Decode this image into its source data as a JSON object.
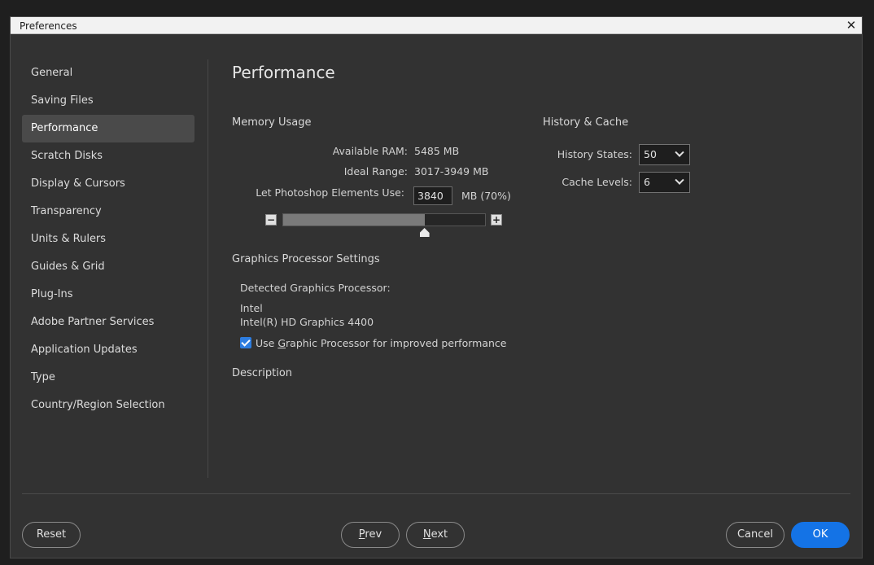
{
  "window": {
    "title": "Preferences",
    "close_glyph": "✕"
  },
  "sidebar": {
    "items": [
      {
        "label": "General"
      },
      {
        "label": "Saving Files"
      },
      {
        "label": "Performance",
        "active": true
      },
      {
        "label": "Scratch Disks"
      },
      {
        "label": "Display & Cursors"
      },
      {
        "label": "Transparency"
      },
      {
        "label": "Units & Rulers"
      },
      {
        "label": "Guides & Grid"
      },
      {
        "label": "Plug-Ins"
      },
      {
        "label": "Adobe Partner Services"
      },
      {
        "label": "Application Updates"
      },
      {
        "label": "Type"
      },
      {
        "label": "Country/Region Selection"
      }
    ]
  },
  "page": {
    "title": "Performance",
    "memory": {
      "section_label": "Memory Usage",
      "available_label": "Available RAM:",
      "available_value": "5485 MB",
      "ideal_label": "Ideal Range:",
      "ideal_value": "3017-3949 MB",
      "use_label": "Let Photoshop Elements Use:",
      "use_value": "3840",
      "use_suffix": "MB (70%)",
      "slider_percent": 70,
      "minus_glyph": "−",
      "plus_glyph": "+"
    },
    "history": {
      "section_label": "History & Cache",
      "states_label": "History States:",
      "states_value": "50",
      "cache_label": "Cache Levels:",
      "cache_value": "6"
    },
    "gpu": {
      "section_label": "Graphics Processor Settings",
      "detected_label": "Detected Graphics Processor:",
      "vendor": "Intel",
      "model": "Intel(R) HD Graphics 4400",
      "use_gpu_pre": "Use ",
      "use_gpu_accel": "G",
      "use_gpu_post": "raphic Processor for improved performance",
      "use_gpu_checked": true
    },
    "description_label": "Description"
  },
  "footer": {
    "reset": "Reset",
    "prev_accel": "P",
    "prev_rest": "rev",
    "next_accel": "N",
    "next_rest": "ext",
    "cancel": "Cancel",
    "ok": "OK"
  },
  "colors": {
    "accent": "#1473e6",
    "background": "#323232"
  }
}
